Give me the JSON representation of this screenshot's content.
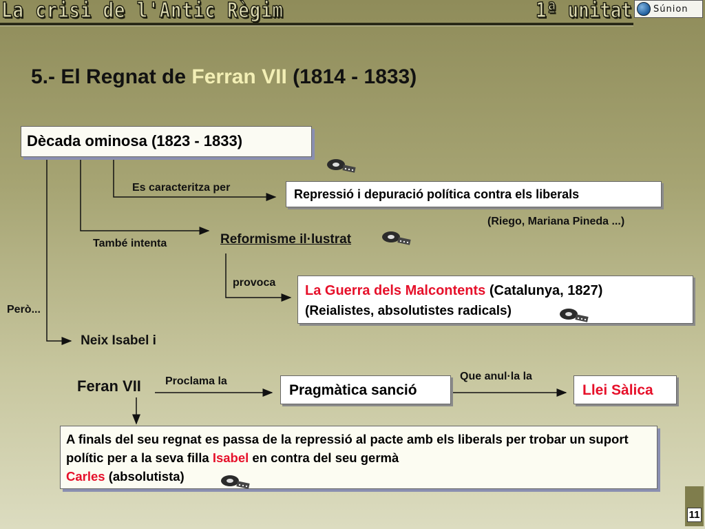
{
  "header": {
    "title": "La crisi de l'Antic Règim",
    "unit": "1ª unitat",
    "logo_text": "Súnion"
  },
  "slide": {
    "title_prefix": "5.- El Regnat de ",
    "title_highlight": "Ferran VII",
    "title_suffix": " (1814 - 1833)"
  },
  "diagram": {
    "decada": "Dècada ominosa (1823 - 1833)",
    "es_caracteritza": "Es caracteritza per",
    "repressio": "Repressió i depuració política contra els liberals",
    "riego": "(Riego, Mariana Pineda ...)",
    "tambe_intenta": "També intenta",
    "reformisme": "Reformisme il·lustrat",
    "provoca": "provoca",
    "guerra_red": "La Guerra dels Malcontents",
    "guerra_rest": " (Catalunya, 1827)",
    "guerra_sub": "(Reialistes, absolutistes radicals)",
    "pero": "Però...",
    "neix_isabel": "Neix Isabel i",
    "feran": "Feran VII",
    "proclama": "Proclama la",
    "pragmatica": "Pragmàtica sanció",
    "que_anul": "Que anul·la la",
    "salica": "Llei Sàlica",
    "finals": {
      "part1": "A finals del seu regnat es passa de la repressió al pacte amb els liberals per trobar un suport polític per a la seva filla ",
      "isabel": "Isabel",
      "part2": "  en contra del seu germà ",
      "carles": "Carles",
      "part3": " (absolutista)"
    }
  },
  "page_number": "11",
  "colors": {
    "highlight": "#f3efb5",
    "accent_red": "#e6102a",
    "background_top": "#8f8c5a",
    "background_bottom": "#dcdcc0"
  },
  "icons": [
    "film-reel-icon",
    "film-reel-icon",
    "film-reel-icon",
    "film-reel-icon",
    "film-reel-icon"
  ]
}
